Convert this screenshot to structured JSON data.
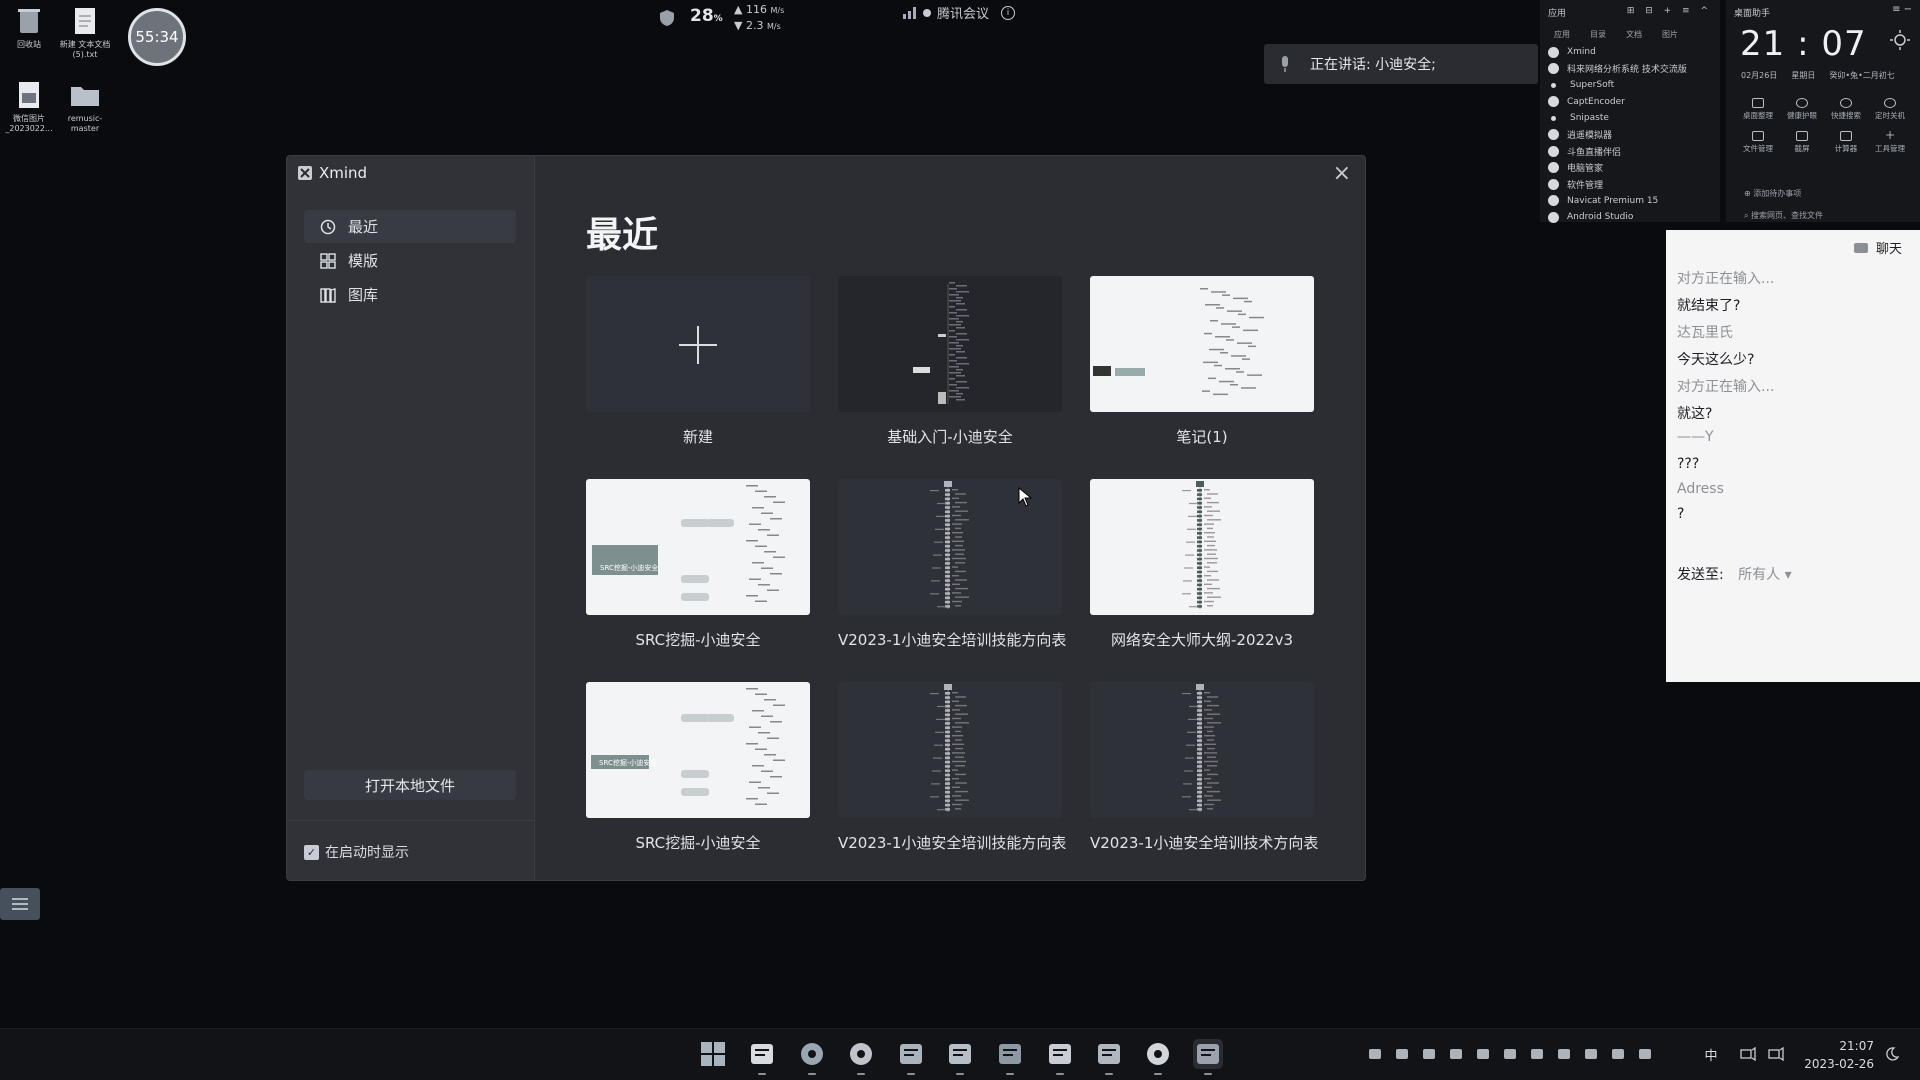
{
  "desktop": {
    "icons": [
      {
        "label": "回收站"
      },
      {
        "label": "新建 文本文档 (5).txt"
      },
      {
        "label": "微信图片_2023022..."
      },
      {
        "label": "remusic-master"
      }
    ],
    "timer": "55:34"
  },
  "topbar": {
    "temperature": "28",
    "temperature_unit": "%",
    "upload": "116",
    "download": "2.3",
    "speed_unit": "M/s",
    "meeting_app": "腾讯会议"
  },
  "speaking_banner": "正在讲话: 小迪安全;",
  "apps_panel": {
    "title": "应用",
    "tabs": [
      "应用",
      "目录",
      "文档",
      "图片"
    ],
    "items": [
      "Xmind",
      "科来网络分析系统 技术交流版",
      "SuperSoft",
      "CaptEncoder",
      "Snipaste",
      "逍遥模拟器",
      "斗鱼直播伴侣",
      "电脑管家",
      "软件管理",
      "Navicat Premium 15",
      "Android Studio"
    ]
  },
  "assistant": {
    "title": "桌面助手",
    "time_h": "21",
    "time_m": "07",
    "date": "02月26日",
    "weekday": "星期日",
    "lunar": "癸卯•兔•二月初七",
    "quick": [
      "桌面整理",
      "健康护眼",
      "快捷搜索",
      "定时关机",
      "文件管理",
      "截屏",
      "计算器",
      "工具管理"
    ],
    "todo": "添加待办事项",
    "search": "搜索网页、查找文件"
  },
  "chat": {
    "title": "聊天",
    "messages": [
      {
        "text": "对方正在输入...",
        "style": "gray"
      },
      {
        "text": "就结束了?",
        "style": "normal"
      },
      {
        "text": "达瓦里氏",
        "style": "gray"
      },
      {
        "text": "今天这么少?",
        "style": "normal"
      },
      {
        "text": "对方正在输入...",
        "style": "gray"
      },
      {
        "text": "就这?",
        "style": "normal"
      },
      {
        "text": "——Y",
        "style": "gray"
      },
      {
        "text": "???",
        "style": "normal"
      },
      {
        "text": "Adress",
        "style": "gray"
      },
      {
        "text": "?",
        "style": "normal"
      }
    ],
    "send_to_label": "发送至:",
    "send_to_value": "所有人"
  },
  "xmind": {
    "app_name": "Xmind",
    "nav": [
      "最近",
      "模版",
      "图库"
    ],
    "heading": "最近",
    "open_local": "打开本地文件",
    "show_on_startup": "在启动时显示",
    "cards": [
      {
        "label": "新建",
        "thumb": "new"
      },
      {
        "label": "基础入门-小迪安全",
        "thumb": "dark-tree"
      },
      {
        "label": "笔记(1)",
        "thumb": "light-tree"
      },
      {
        "label": "SRC挖掘-小迪安全",
        "thumb": "light-src"
      },
      {
        "label": "V2023-1小迪安全培训技能方向表",
        "thumb": "dark-vertical"
      },
      {
        "label": "网络安全大师大纲-2022v3",
        "thumb": "light-vertical"
      },
      {
        "label": "SRC挖掘-小迪安全",
        "thumb": "light-src"
      },
      {
        "label": "V2023-1小迪安全培训技能方向表",
        "thumb": "dark-vertical"
      },
      {
        "label": "V2023-1小迪安全培训技术方向表",
        "thumb": "dark-vertical"
      }
    ],
    "src_center": "SRC挖掘-小迪安全"
  },
  "taskbar": {
    "apps": [
      "start",
      "file-explorer",
      "edge",
      "chrome",
      "store",
      "photos",
      "vmware",
      "plugin",
      "notepad",
      "wechat",
      "xmind"
    ],
    "ime": "中",
    "clock_time": "21:07",
    "clock_date": "2023-02-26"
  },
  "colors": {
    "window_bg": "#2b2d33",
    "sidebar_bg": "#303238",
    "chat_gray": "#8d9096"
  }
}
